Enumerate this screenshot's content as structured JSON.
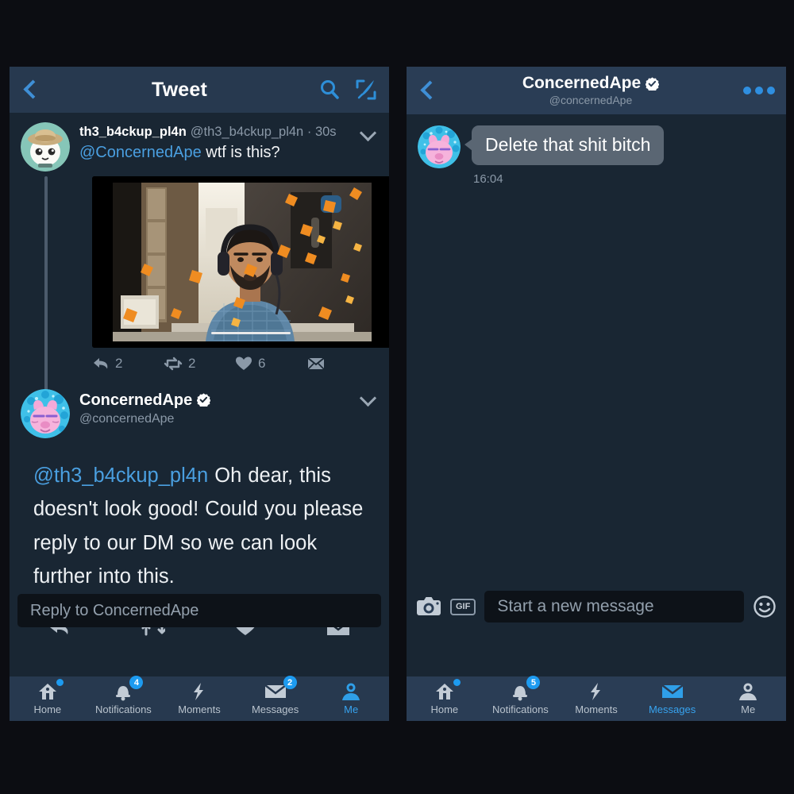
{
  "theme": {
    "page_bg": "#0c0d12",
    "panel_bg": "#192633",
    "bar_bg": "#27394f",
    "accent_blue": "#1d9bf0",
    "link_blue": "#4a9fe0",
    "muted_text": "#8b99a8",
    "bubble_bg": "#5a6673"
  },
  "left_panel": {
    "header": {
      "back_label": "Back",
      "title": "Tweet",
      "search_icon": "search-icon",
      "compose_icon": "compose-icon"
    },
    "reply_tweet": {
      "avatar_icon": "avatar-th3-b4ckup-pl4n",
      "display_name": "th3_b4ckup_pl4n",
      "handle": "@th3_b4ckup_pl4n",
      "separator": "·",
      "timestamp": "30s",
      "mention": "@ConcernedApe",
      "text": "wtf is this?",
      "caret_icon": "chevron-down-icon",
      "media": {
        "type": "video-thumbnail",
        "description": "man with headphones at desk, autumn leaves overlay"
      },
      "actions": [
        {
          "icon": "reply-icon",
          "count": "2"
        },
        {
          "icon": "retweet-icon",
          "count": "2"
        },
        {
          "icon": "like-icon",
          "count": "6"
        },
        {
          "icon": "dm-icon",
          "count": ""
        }
      ]
    },
    "main_tweet": {
      "avatar_icon": "avatar-concernedape",
      "display_name": "ConcernedApe",
      "handle": "@concernedApe",
      "verified": true,
      "caret_icon": "chevron-down-icon",
      "mention": "@th3_b4ckup_pl4n",
      "text": "Oh dear, this doesn't look  good! Could you please reply to our DM  so we can look  further into this.",
      "actions": [
        {
          "icon": "reply-icon"
        },
        {
          "icon": "retweet-icon"
        },
        {
          "icon": "like-icon"
        },
        {
          "icon": "dm-icon"
        }
      ]
    },
    "composer": {
      "placeholder": "Reply to ConcernedApe"
    },
    "nav": [
      {
        "name": "home",
        "label": "Home",
        "icon": "home-icon",
        "badge": "",
        "dot": true,
        "active": false
      },
      {
        "name": "notifications",
        "label": "Notifications",
        "icon": "bell-icon",
        "badge": "4",
        "dot": false,
        "active": false
      },
      {
        "name": "moments",
        "label": "Moments",
        "icon": "lightning-icon",
        "badge": "",
        "dot": false,
        "active": false
      },
      {
        "name": "messages",
        "label": "Messages",
        "icon": "envelope-icon",
        "badge": "2",
        "dot": false,
        "active": false
      },
      {
        "name": "me",
        "label": "Me",
        "icon": "person-icon",
        "badge": "",
        "dot": false,
        "active": true
      }
    ]
  },
  "right_panel": {
    "header": {
      "back_label": "Back",
      "name": "ConcernedApe",
      "handle": "@concernedApe",
      "verified": true,
      "more_icon": "more-dots-icon"
    },
    "messages": [
      {
        "avatar_icon": "avatar-concernedape",
        "text": "Delete that shit bitch",
        "time": "16:04",
        "incoming": true
      }
    ],
    "input_bar": {
      "camera_icon": "camera-icon",
      "gif_label": "GIF",
      "placeholder": "Start a new message",
      "emoji_icon": "smiley-icon"
    },
    "nav": [
      {
        "name": "home",
        "label": "Home",
        "icon": "home-icon",
        "badge": "",
        "dot": true,
        "active": false
      },
      {
        "name": "notifications",
        "label": "Notifications",
        "icon": "bell-icon",
        "badge": "5",
        "dot": false,
        "active": false
      },
      {
        "name": "moments",
        "label": "Moments",
        "icon": "lightning-icon",
        "badge": "",
        "dot": false,
        "active": false
      },
      {
        "name": "messages",
        "label": "Messages",
        "icon": "envelope-icon",
        "badge": "",
        "dot": false,
        "active": true
      },
      {
        "name": "me",
        "label": "Me",
        "icon": "person-icon",
        "badge": "",
        "dot": false,
        "active": false
      }
    ]
  }
}
